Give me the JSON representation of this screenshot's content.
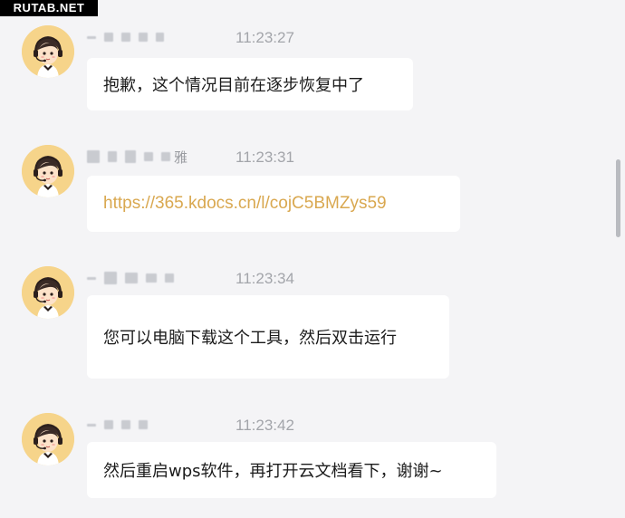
{
  "watermark": "RUTAB.NET",
  "messages": [
    {
      "time": "11:23:27",
      "name_tail": "",
      "text": "抱歉，这个情况目前在逐步恢复中了",
      "is_link": false
    },
    {
      "time": "11:23:31",
      "name_tail": "雅",
      "text": "https://365.kdocs.cn/l/cojC5BMZys59",
      "is_link": true
    },
    {
      "time": "11:23:34",
      "name_tail": "",
      "text": "您可以电脑下载这个工具，然后双击运行",
      "is_link": false
    },
    {
      "time": "11:23:42",
      "name_tail": "",
      "text": "然后重启wps软件，再打开云文档看下，谢谢~",
      "is_link": false
    }
  ],
  "colors": {
    "link": "#d9a850",
    "avatar_bg": "#f6d48a",
    "background": "#f4f4f6"
  },
  "icons": {
    "avatar": "customer-service-agent-avatar"
  }
}
